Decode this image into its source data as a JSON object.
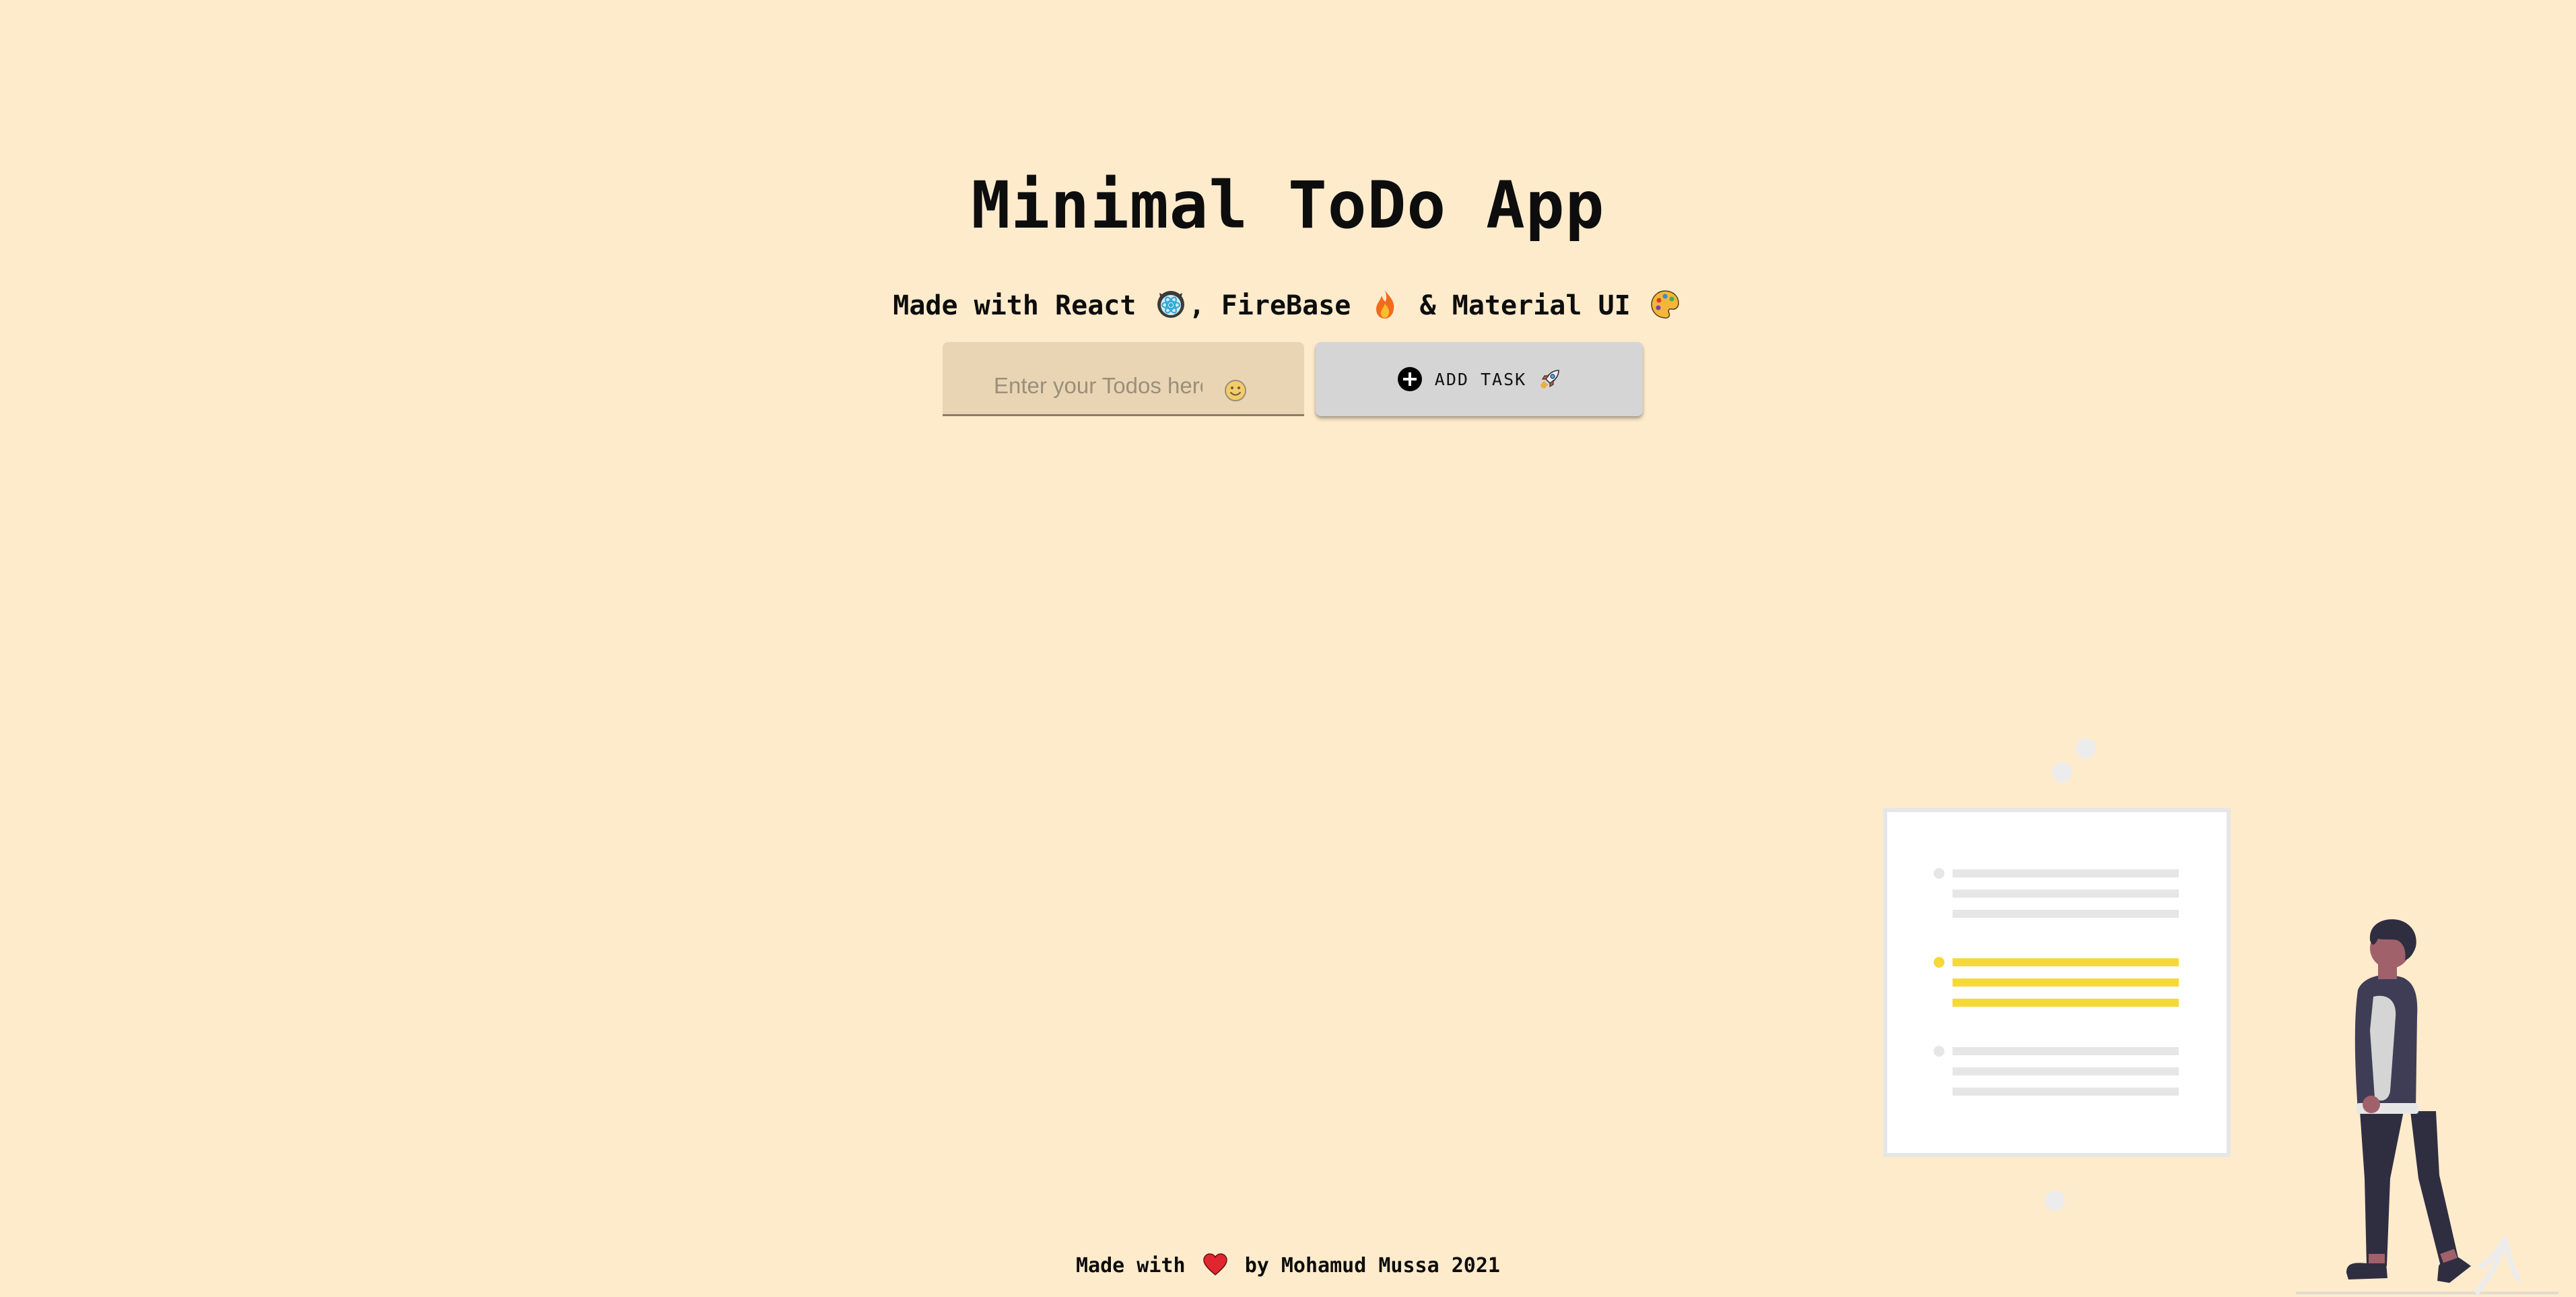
{
  "header": {
    "title": "Minimal ToDo App",
    "subtitle_part1": "Made with React",
    "subtitle_part2": ", FireBase",
    "subtitle_part3": "& Material UI"
  },
  "form": {
    "input_placeholder": "Enter your Todos here",
    "input_value": "",
    "add_button_label": "ADD TASK"
  },
  "footer": {
    "made_with": "Made with",
    "by_line": "by Mohamud Mussa 2021"
  },
  "icons": {
    "subtitle": [
      "react-icon",
      "fire-icon",
      "palette-icon"
    ],
    "input": "smile-icon",
    "button": [
      "plus-circle-icon",
      "rocket-icon"
    ],
    "footer": "heart-icon"
  },
  "colors": {
    "background": "#feebcc",
    "input_bg": "#e9d5b4",
    "button_bg": "#d5d5d5",
    "accent_yellow": "#f5d939",
    "heart": "#e0262e",
    "figure_dark": "#2f2e41"
  }
}
